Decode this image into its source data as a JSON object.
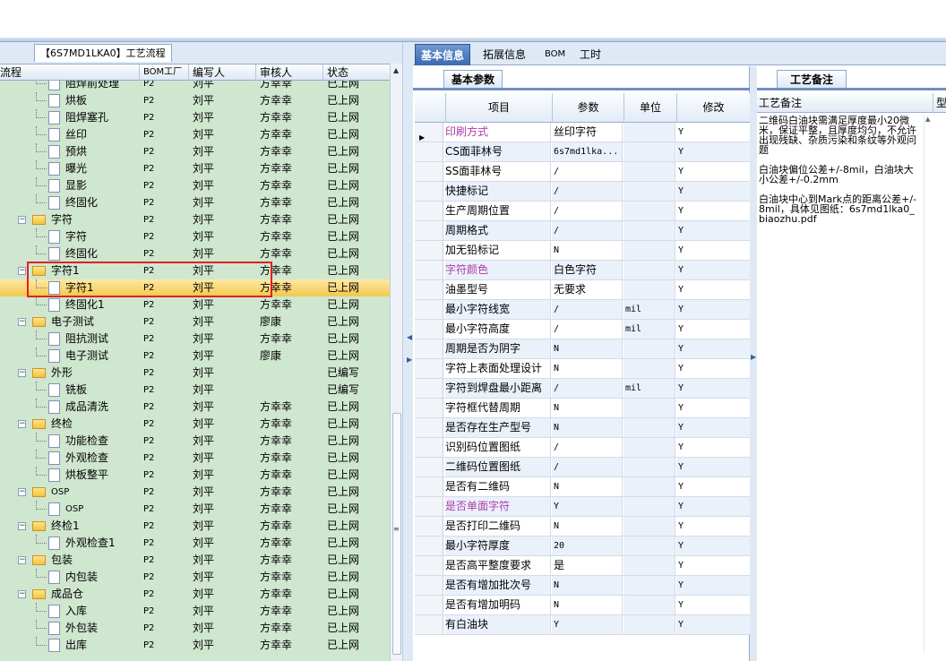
{
  "left_panel": {
    "tab_label": "【6S7MD1LKA0】工艺流程",
    "columns": [
      "流程",
      "BOM工厂",
      "编写人",
      "审核人",
      "状态"
    ],
    "rows": [
      {
        "name": "阻焊前处理",
        "level": 2,
        "type": "doc",
        "bom": "P2",
        "writer": "刘平",
        "reviewer": "方幸幸",
        "status": "已上网"
      },
      {
        "name": "烘板",
        "level": 2,
        "type": "doc",
        "bom": "P2",
        "writer": "刘平",
        "reviewer": "方幸幸",
        "status": "已上网"
      },
      {
        "name": "阻焊塞孔",
        "level": 2,
        "type": "doc",
        "bom": "P2",
        "writer": "刘平",
        "reviewer": "方幸幸",
        "status": "已上网"
      },
      {
        "name": "丝印",
        "level": 2,
        "type": "doc",
        "bom": "P2",
        "writer": "刘平",
        "reviewer": "方幸幸",
        "status": "已上网"
      },
      {
        "name": "预烘",
        "level": 2,
        "type": "doc",
        "bom": "P2",
        "writer": "刘平",
        "reviewer": "方幸幸",
        "status": "已上网"
      },
      {
        "name": "曝光",
        "level": 2,
        "type": "doc",
        "bom": "P2",
        "writer": "刘平",
        "reviewer": "方幸幸",
        "status": "已上网"
      },
      {
        "name": "显影",
        "level": 2,
        "type": "doc",
        "bom": "P2",
        "writer": "刘平",
        "reviewer": "方幸幸",
        "status": "已上网"
      },
      {
        "name": "终固化",
        "level": 2,
        "type": "doc",
        "bom": "P2",
        "writer": "刘平",
        "reviewer": "方幸幸",
        "status": "已上网"
      },
      {
        "name": "字符",
        "level": 1,
        "type": "folder",
        "bom": "P2",
        "writer": "刘平",
        "reviewer": "方幸幸",
        "status": "已上网"
      },
      {
        "name": "字符",
        "level": 2,
        "type": "doc",
        "bom": "P2",
        "writer": "刘平",
        "reviewer": "方幸幸",
        "status": "已上网"
      },
      {
        "name": "终固化",
        "level": 2,
        "type": "doc",
        "bom": "P2",
        "writer": "刘平",
        "reviewer": "方幸幸",
        "status": "已上网"
      },
      {
        "name": "字符1",
        "level": 1,
        "type": "folder",
        "bom": "P2",
        "writer": "刘平",
        "reviewer": "方幸幸",
        "status": "已上网"
      },
      {
        "name": "字符1",
        "level": 2,
        "type": "doc",
        "bom": "P2",
        "writer": "刘平",
        "reviewer": "方幸幸",
        "status": "已上网",
        "selected": true
      },
      {
        "name": "终固化1",
        "level": 2,
        "type": "doc",
        "bom": "P2",
        "writer": "刘平",
        "reviewer": "方幸幸",
        "status": "已上网"
      },
      {
        "name": "电子测试",
        "level": 1,
        "type": "folder",
        "bom": "P2",
        "writer": "刘平",
        "reviewer": "廖康",
        "status": "已上网"
      },
      {
        "name": "阻抗测试",
        "level": 2,
        "type": "doc",
        "bom": "P2",
        "writer": "刘平",
        "reviewer": "方幸幸",
        "status": "已上网"
      },
      {
        "name": "电子测试",
        "level": 2,
        "type": "doc",
        "bom": "P2",
        "writer": "刘平",
        "reviewer": "廖康",
        "status": "已上网"
      },
      {
        "name": "外形",
        "level": 1,
        "type": "folder",
        "bom": "P2",
        "writer": "刘平",
        "reviewer": "",
        "status": "已编写"
      },
      {
        "name": "铣板",
        "level": 2,
        "type": "doc",
        "bom": "P2",
        "writer": "刘平",
        "reviewer": "",
        "status": "已编写"
      },
      {
        "name": "成品清洗",
        "level": 2,
        "type": "doc",
        "bom": "P2",
        "writer": "刘平",
        "reviewer": "方幸幸",
        "status": "已上网"
      },
      {
        "name": "终检",
        "level": 1,
        "type": "folder",
        "bom": "P2",
        "writer": "刘平",
        "reviewer": "方幸幸",
        "status": "已上网"
      },
      {
        "name": "功能检查",
        "level": 2,
        "type": "doc",
        "bom": "P2",
        "writer": "刘平",
        "reviewer": "方幸幸",
        "status": "已上网"
      },
      {
        "name": "外观检查",
        "level": 2,
        "type": "doc",
        "bom": "P2",
        "writer": "刘平",
        "reviewer": "方幸幸",
        "status": "已上网"
      },
      {
        "name": "烘板整平",
        "level": 2,
        "type": "doc",
        "bom": "P2",
        "writer": "刘平",
        "reviewer": "方幸幸",
        "status": "已上网"
      },
      {
        "name": "OSP",
        "level": 1,
        "type": "folder",
        "bom": "P2",
        "writer": "刘平",
        "reviewer": "方幸幸",
        "status": "已上网"
      },
      {
        "name": "OSP",
        "level": 2,
        "type": "doc",
        "bom": "P2",
        "writer": "刘平",
        "reviewer": "方幸幸",
        "status": "已上网"
      },
      {
        "name": "终检1",
        "level": 1,
        "type": "folder",
        "bom": "P2",
        "writer": "刘平",
        "reviewer": "方幸幸",
        "status": "已上网"
      },
      {
        "name": "外观检查1",
        "level": 2,
        "type": "doc",
        "bom": "P2",
        "writer": "刘平",
        "reviewer": "方幸幸",
        "status": "已上网"
      },
      {
        "name": "包装",
        "level": 1,
        "type": "folder",
        "bom": "P2",
        "writer": "刘平",
        "reviewer": "方幸幸",
        "status": "已上网"
      },
      {
        "name": "内包装",
        "level": 2,
        "type": "doc",
        "bom": "P2",
        "writer": "刘平",
        "reviewer": "方幸幸",
        "status": "已上网"
      },
      {
        "name": "成品仓",
        "level": 1,
        "type": "folder",
        "bom": "P2",
        "writer": "刘平",
        "reviewer": "方幸幸",
        "status": "已上网"
      },
      {
        "name": "入库",
        "level": 2,
        "type": "doc",
        "bom": "P2",
        "writer": "刘平",
        "reviewer": "方幸幸",
        "status": "已上网"
      },
      {
        "name": "外包装",
        "level": 2,
        "type": "doc",
        "bom": "P2",
        "writer": "刘平",
        "reviewer": "方幸幸",
        "status": "已上网"
      },
      {
        "name": "出库",
        "level": 2,
        "type": "doc",
        "bom": "P2",
        "writer": "刘平",
        "reviewer": "方幸幸",
        "status": "已上网"
      }
    ]
  },
  "right_tabs": [
    "基本信息",
    "拓展信息",
    "BOM",
    "工时"
  ],
  "params_panel": {
    "tab_label": "基本参数",
    "columns": [
      "项目",
      "参数",
      "单位",
      "修改"
    ],
    "rows": [
      {
        "item": "印刷方式",
        "value": "丝印字符",
        "unit": "",
        "edit": "Y",
        "highlight": true,
        "current": true
      },
      {
        "item": "CS面菲林号",
        "value": "6s7md1lka...",
        "unit": "",
        "edit": "Y"
      },
      {
        "item": "SS面菲林号",
        "value": "/",
        "unit": "",
        "edit": "Y"
      },
      {
        "item": "快捷标记",
        "value": "/",
        "unit": "",
        "edit": "Y"
      },
      {
        "item": "生产周期位置",
        "value": "/",
        "unit": "",
        "edit": "Y"
      },
      {
        "item": "周期格式",
        "value": "/",
        "unit": "",
        "edit": "Y"
      },
      {
        "item": "加无铅标记",
        "value": "N",
        "unit": "",
        "edit": "Y"
      },
      {
        "item": "字符颜色",
        "value": "白色字符",
        "unit": "",
        "edit": "Y",
        "highlight": true
      },
      {
        "item": "油墨型号",
        "value": "无要求",
        "unit": "",
        "edit": "Y"
      },
      {
        "item": "最小字符线宽",
        "value": "/",
        "unit": "mil",
        "edit": "Y"
      },
      {
        "item": "最小字符高度",
        "value": "/",
        "unit": "mil",
        "edit": "Y"
      },
      {
        "item": "周期是否为阴字",
        "value": "N",
        "unit": "",
        "edit": "Y"
      },
      {
        "item": "字符上表面处理设计",
        "value": "N",
        "unit": "",
        "edit": "Y"
      },
      {
        "item": "字符到焊盘最小距离",
        "value": "/",
        "unit": "mil",
        "edit": "Y"
      },
      {
        "item": "字符框代替周期",
        "value": "N",
        "unit": "",
        "edit": "Y"
      },
      {
        "item": "是否存在生产型号",
        "value": "N",
        "unit": "",
        "edit": "Y"
      },
      {
        "item": "识别码位置图纸",
        "value": "/",
        "unit": "",
        "edit": "Y"
      },
      {
        "item": "二维码位置图纸",
        "value": "/",
        "unit": "",
        "edit": "Y"
      },
      {
        "item": "是否有二维码",
        "value": "N",
        "unit": "",
        "edit": "Y"
      },
      {
        "item": "是否单面字符",
        "value": "Y",
        "unit": "",
        "edit": "Y",
        "highlight": true
      },
      {
        "item": "是否打印二维码",
        "value": "N",
        "unit": "",
        "edit": "Y"
      },
      {
        "item": "最小字符厚度",
        "value": "20",
        "unit": "",
        "edit": "Y"
      },
      {
        "item": "是否高平整度要求",
        "value": "是",
        "unit": "",
        "edit": "Y"
      },
      {
        "item": "是否有增加批次号",
        "value": "N",
        "unit": "",
        "edit": "Y"
      },
      {
        "item": "是否有增加明码",
        "value": "N",
        "unit": "",
        "edit": "Y"
      },
      {
        "item": "有白油块",
        "value": "Y",
        "unit": "",
        "edit": "Y"
      }
    ]
  },
  "notes_panel": {
    "tab_label": "工艺备注",
    "column": "工艺备注",
    "column2": "型",
    "text": "二维码白油块需满足厚度最小20微米，保证平整，且厚度均匀，不允许出现残缺、杂质污染和条纹等外观问题\n\n白油块偏位公差+/-8mil，白油块大小公差+/-0.2mm\n\n白油块中心到Mark点的距离公差+/-8mil，具体见图纸：6s7md1lka0_biaozhu.pdf"
  },
  "colors": {
    "accent": "#3a69b0",
    "tree_bg": "#cfe6cf",
    "selected": "#f4c84d",
    "highlight_text": "#b03aa8",
    "red_box": "#e02020"
  }
}
